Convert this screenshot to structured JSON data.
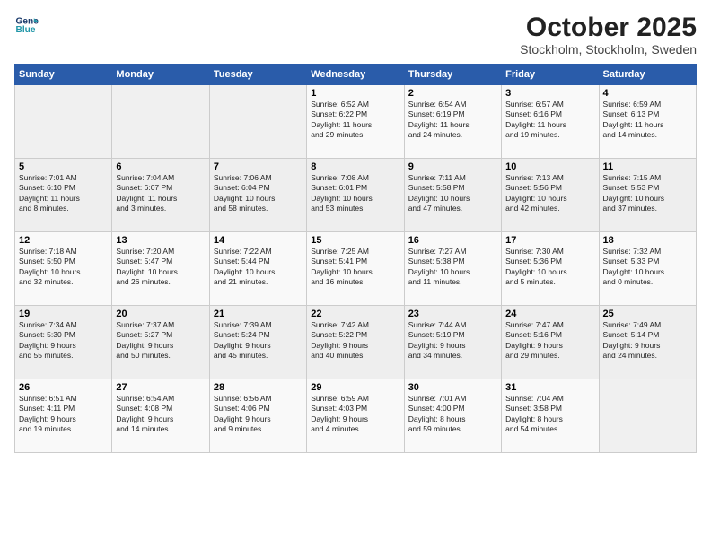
{
  "header": {
    "logo_line1": "General",
    "logo_line2": "Blue",
    "title": "October 2025",
    "subtitle": "Stockholm, Stockholm, Sweden"
  },
  "weekdays": [
    "Sunday",
    "Monday",
    "Tuesday",
    "Wednesday",
    "Thursday",
    "Friday",
    "Saturday"
  ],
  "weeks": [
    [
      {
        "day": "",
        "info": ""
      },
      {
        "day": "",
        "info": ""
      },
      {
        "day": "",
        "info": ""
      },
      {
        "day": "1",
        "info": "Sunrise: 6:52 AM\nSunset: 6:22 PM\nDaylight: 11 hours\nand 29 minutes."
      },
      {
        "day": "2",
        "info": "Sunrise: 6:54 AM\nSunset: 6:19 PM\nDaylight: 11 hours\nand 24 minutes."
      },
      {
        "day": "3",
        "info": "Sunrise: 6:57 AM\nSunset: 6:16 PM\nDaylight: 11 hours\nand 19 minutes."
      },
      {
        "day": "4",
        "info": "Sunrise: 6:59 AM\nSunset: 6:13 PM\nDaylight: 11 hours\nand 14 minutes."
      }
    ],
    [
      {
        "day": "5",
        "info": "Sunrise: 7:01 AM\nSunset: 6:10 PM\nDaylight: 11 hours\nand 8 minutes."
      },
      {
        "day": "6",
        "info": "Sunrise: 7:04 AM\nSunset: 6:07 PM\nDaylight: 11 hours\nand 3 minutes."
      },
      {
        "day": "7",
        "info": "Sunrise: 7:06 AM\nSunset: 6:04 PM\nDaylight: 10 hours\nand 58 minutes."
      },
      {
        "day": "8",
        "info": "Sunrise: 7:08 AM\nSunset: 6:01 PM\nDaylight: 10 hours\nand 53 minutes."
      },
      {
        "day": "9",
        "info": "Sunrise: 7:11 AM\nSunset: 5:58 PM\nDaylight: 10 hours\nand 47 minutes."
      },
      {
        "day": "10",
        "info": "Sunrise: 7:13 AM\nSunset: 5:56 PM\nDaylight: 10 hours\nand 42 minutes."
      },
      {
        "day": "11",
        "info": "Sunrise: 7:15 AM\nSunset: 5:53 PM\nDaylight: 10 hours\nand 37 minutes."
      }
    ],
    [
      {
        "day": "12",
        "info": "Sunrise: 7:18 AM\nSunset: 5:50 PM\nDaylight: 10 hours\nand 32 minutes."
      },
      {
        "day": "13",
        "info": "Sunrise: 7:20 AM\nSunset: 5:47 PM\nDaylight: 10 hours\nand 26 minutes."
      },
      {
        "day": "14",
        "info": "Sunrise: 7:22 AM\nSunset: 5:44 PM\nDaylight: 10 hours\nand 21 minutes."
      },
      {
        "day": "15",
        "info": "Sunrise: 7:25 AM\nSunset: 5:41 PM\nDaylight: 10 hours\nand 16 minutes."
      },
      {
        "day": "16",
        "info": "Sunrise: 7:27 AM\nSunset: 5:38 PM\nDaylight: 10 hours\nand 11 minutes."
      },
      {
        "day": "17",
        "info": "Sunrise: 7:30 AM\nSunset: 5:36 PM\nDaylight: 10 hours\nand 5 minutes."
      },
      {
        "day": "18",
        "info": "Sunrise: 7:32 AM\nSunset: 5:33 PM\nDaylight: 10 hours\nand 0 minutes."
      }
    ],
    [
      {
        "day": "19",
        "info": "Sunrise: 7:34 AM\nSunset: 5:30 PM\nDaylight: 9 hours\nand 55 minutes."
      },
      {
        "day": "20",
        "info": "Sunrise: 7:37 AM\nSunset: 5:27 PM\nDaylight: 9 hours\nand 50 minutes."
      },
      {
        "day": "21",
        "info": "Sunrise: 7:39 AM\nSunset: 5:24 PM\nDaylight: 9 hours\nand 45 minutes."
      },
      {
        "day": "22",
        "info": "Sunrise: 7:42 AM\nSunset: 5:22 PM\nDaylight: 9 hours\nand 40 minutes."
      },
      {
        "day": "23",
        "info": "Sunrise: 7:44 AM\nSunset: 5:19 PM\nDaylight: 9 hours\nand 34 minutes."
      },
      {
        "day": "24",
        "info": "Sunrise: 7:47 AM\nSunset: 5:16 PM\nDaylight: 9 hours\nand 29 minutes."
      },
      {
        "day": "25",
        "info": "Sunrise: 7:49 AM\nSunset: 5:14 PM\nDaylight: 9 hours\nand 24 minutes."
      }
    ],
    [
      {
        "day": "26",
        "info": "Sunrise: 6:51 AM\nSunset: 4:11 PM\nDaylight: 9 hours\nand 19 minutes."
      },
      {
        "day": "27",
        "info": "Sunrise: 6:54 AM\nSunset: 4:08 PM\nDaylight: 9 hours\nand 14 minutes."
      },
      {
        "day": "28",
        "info": "Sunrise: 6:56 AM\nSunset: 4:06 PM\nDaylight: 9 hours\nand 9 minutes."
      },
      {
        "day": "29",
        "info": "Sunrise: 6:59 AM\nSunset: 4:03 PM\nDaylight: 9 hours\nand 4 minutes."
      },
      {
        "day": "30",
        "info": "Sunrise: 7:01 AM\nSunset: 4:00 PM\nDaylight: 8 hours\nand 59 minutes."
      },
      {
        "day": "31",
        "info": "Sunrise: 7:04 AM\nSunset: 3:58 PM\nDaylight: 8 hours\nand 54 minutes."
      },
      {
        "day": "",
        "info": ""
      }
    ]
  ]
}
